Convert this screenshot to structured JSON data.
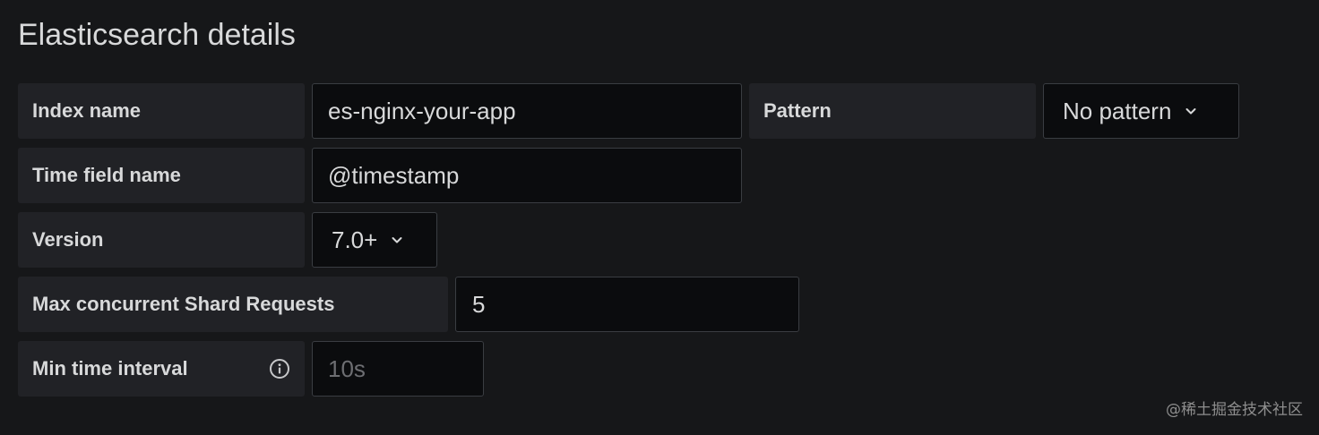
{
  "section": {
    "title": "Elasticsearch details"
  },
  "fields": {
    "index_name": {
      "label": "Index name",
      "value": "es-nginx-your-app"
    },
    "pattern": {
      "label": "Pattern",
      "value": "No pattern",
      "icon": "chevron-down-icon"
    },
    "time_field_name": {
      "label": "Time field name",
      "value": "@timestamp"
    },
    "version": {
      "label": "Version",
      "value": "7.0+",
      "icon": "chevron-down-icon"
    },
    "max_shard_requests": {
      "label": "Max concurrent Shard Requests",
      "value": "5"
    },
    "min_time_interval": {
      "label": "Min time interval",
      "placeholder": "10s",
      "icon": "info-circle-icon"
    }
  },
  "watermark": {
    "text": "@稀土掘金技术社区"
  },
  "colors": {
    "background": "#161719",
    "label_bg": "#212226",
    "input_bg": "#0b0c0e",
    "input_border": "#3a3d42",
    "text": "#d8d9da",
    "placeholder": "#6d6e72"
  }
}
